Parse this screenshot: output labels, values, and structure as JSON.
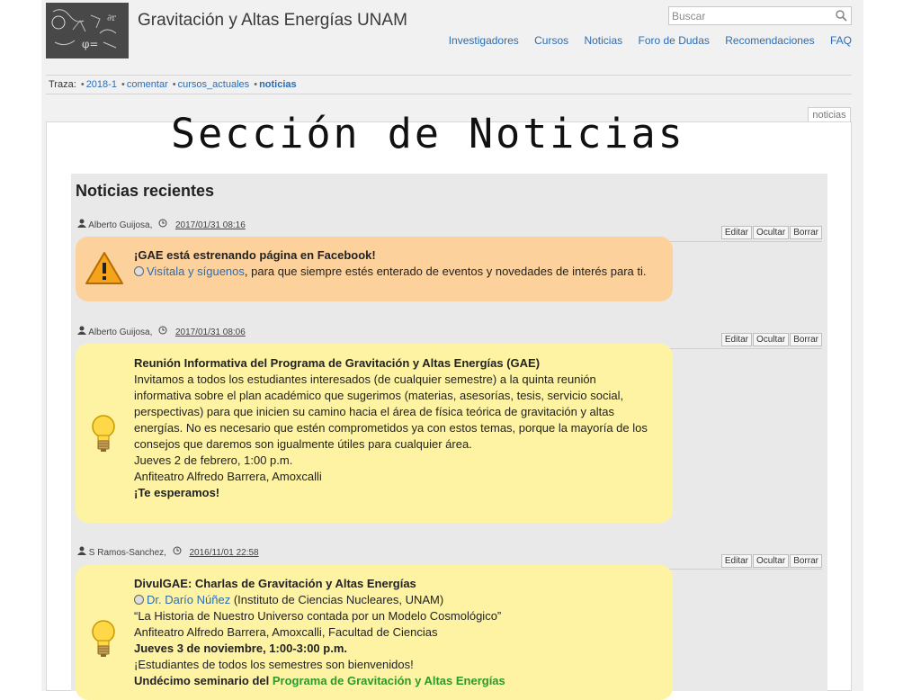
{
  "site": {
    "title": "Gravitación y Altas Energías UNAM",
    "search_placeholder": "Buscar"
  },
  "nav": [
    "Investigadores",
    "Cursos",
    "Noticias",
    "Foro de Dudas",
    "Recomendaciones",
    "FAQ"
  ],
  "trail": {
    "label": "Traza:",
    "items": [
      "2018-1",
      "comentar",
      "cursos_actuales",
      "noticias"
    ]
  },
  "page_tab": "noticias",
  "overlay_title": "Sección de Noticias",
  "news": {
    "heading": "Noticias recientes",
    "actions": [
      "Editar",
      "Ocultar",
      "Borrar"
    ],
    "posts": [
      {
        "author": "Alberto Guijosa,",
        "date": "2017/01/31 08:16",
        "title": "¡GAE está estrenando página en Facebook!",
        "link": "Visítala y síguenos",
        "tail": ", para que siempre estés enterado de eventos y novedades de interés para ti."
      },
      {
        "author": "Alberto Guijosa,",
        "date": "2017/01/31 08:06",
        "title": "Reunión Informativa del Programa de Gravitación y Altas Energías (GAE)",
        "lines": [
          "Invitamos a todos los estudiantes interesados (de cualquier semestre) a la quinta reunión",
          "informativa sobre el plan académico que sugerimos (materias, asesorías, tesis, servicio social,",
          "perspectivas) para que inicien su camino hacia el área de física teórica de gravitación y altas",
          "energías. No es necesario que estén comprometidos ya con estos temas, porque la mayoría de los",
          "consejos que daremos son igualmente útiles para cualquier área.",
          "Jueves 2 de febrero, 1:00 p.m.",
          "Anfiteatro Alfredo Barrera, Amoxcalli"
        ],
        "closing": "¡Te esperamos!"
      },
      {
        "author": "S Ramos-Sanchez,",
        "date": "2016/11/01 22:58",
        "title": "DivulGAE: Charlas de Gravitación y Altas Energías",
        "link": "Dr. Darío Núñez",
        "link_tail": " (Instituto de Ciencias Nucleares, UNAM)",
        "talk": "“La Historia de Nuestro Universo contada por un Modelo Cosmológico”",
        "place": "Anfiteatro Alfredo Barrera, Amoxcalli, Facultad de Ciencias",
        "when": "Jueves 3 de noviembre, 1:00-3:00 p.m.",
        "welcome": "¡Estudiantes de todos los semestres son bienvenidos!",
        "seminar_prefix": "Undécimo seminario del ",
        "seminar_link": "Programa de Gravitación y Altas Energías"
      }
    ]
  },
  "icons": [
    "warning-icon",
    "lightbulb-icon",
    "globe-icon",
    "user-icon",
    "clock-icon",
    "search-icon"
  ]
}
